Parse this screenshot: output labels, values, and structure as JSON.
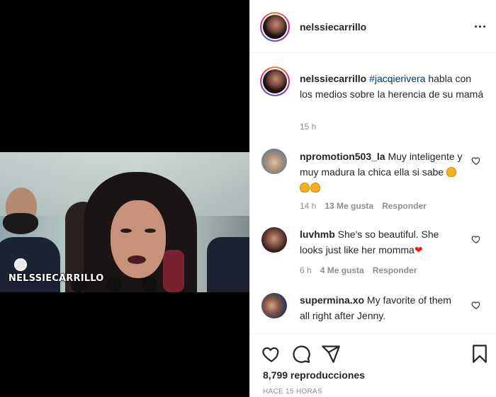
{
  "media": {
    "watermark": "NELSSIECARRILLO"
  },
  "header": {
    "username": "nelssiecarrillo",
    "more_icon": "more-horizontal-icon"
  },
  "caption": {
    "username": "nelssiecarrillo",
    "hashtag": "#jacqierivera",
    "text": " habla con los medios sobre la herencia de su mamá",
    "time": "15 h"
  },
  "comments": [
    {
      "username": "npromotion503_la",
      "text": " Muy inteligente y muy madura la chica ella si sabe ",
      "emoji": "👏👏👏",
      "time": "14 h",
      "likes": "13 Me gusta",
      "reply": "Responder"
    },
    {
      "username": "luvhmb",
      "text": " She's so beautiful. She looks just like her momma",
      "emoji": "❤",
      "time": "6 h",
      "likes": "4 Me gusta",
      "reply": "Responder"
    },
    {
      "username": "supermina.xo",
      "text": " My favorite of them all right after Jenny."
    }
  ],
  "actions": {
    "icons": [
      "heart-icon",
      "comment-icon",
      "share-icon",
      "save-icon"
    ],
    "views": "8,799 reproducciones",
    "posted": "HACE 15 HORAS"
  },
  "colors": {
    "text": "#262626",
    "secondary": "#8e8e8e",
    "hashtag": "#00376b",
    "divider": "#efefef"
  }
}
